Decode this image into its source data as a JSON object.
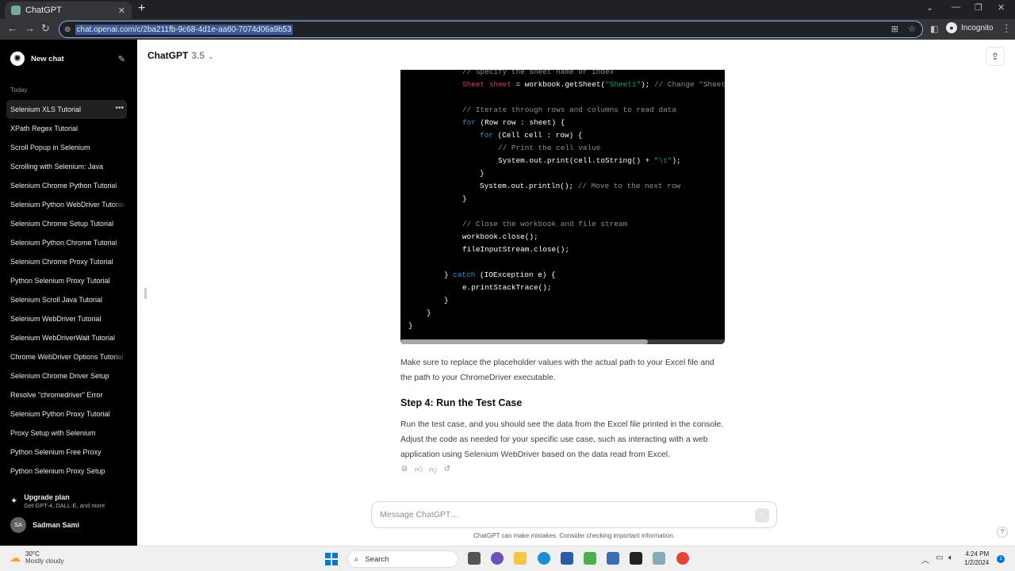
{
  "browser": {
    "tab_title": "ChatGPT",
    "url": "chat.openai.com/c/2ba211fb-9c68-4d1e-aa60-7074d06a9b53",
    "incognito_label": "Incognito"
  },
  "sidebar": {
    "new_chat_label": "New chat",
    "section_label": "Today",
    "history": [
      "Selenium XLS Tutorial",
      "XPath Regex Tutorial",
      "Scroll Popup in Selenium",
      "Scrolling with Selenium: Java",
      "Selenium Chrome Python Tutorial",
      "Selenium Python WebDriver Tutorial",
      "Selenium Chrome Setup Tutorial",
      "Selenium Python Chrome Tutorial",
      "Selenium Chrome Proxy Tutorial",
      "Python Selenium Proxy Tutorial",
      "Selenium Scroll Java Tutorial",
      "Selenium WebDriver Tutorial",
      "Selenium WebDriverWait Tutorial",
      "Chrome WebDriver Options Tutorial",
      "Selenium Chrome Driver Setup",
      "Resolve \"chromedriver\" Error",
      "Selenium Python Proxy Tutorial",
      "Proxy Setup with Selenium",
      "Python Selenium Free Proxy",
      "Python Selenium Proxy Setup"
    ],
    "upgrade_title": "Upgrade plan",
    "upgrade_sub": "Get GPT-4, DALL·E, and more",
    "user_initials": "SA",
    "user_name": "Sadman Sami"
  },
  "main": {
    "model_name": "ChatGPT",
    "model_version": "3.5",
    "code": {
      "l1": "// Specify the sheet name or index",
      "l2_type": "Sheet",
      "l2_var": "sheet",
      "l2_mid": " = workbook.getSheet(",
      "l2_str": "\"Sheet1\"",
      "l2_end": ");",
      "l2_cm": "// Change \"Sheet",
      "l3": "// Iterate through rows and columns to read data",
      "l4_kw": "for",
      "l4_rest": " (Row row : sheet) {",
      "l5_kw": "for",
      "l5_rest": " (Cell cell : row) {",
      "l6": "// Print the cell value",
      "l7_a": "System.out.print(cell.toString() + ",
      "l7_str": "\"\\t\"",
      "l7_b": ");",
      "l8": "}",
      "l9_a": "System.out.println(); ",
      "l9_cm": "// Move to the next row",
      "l10": "}",
      "l11": "// Close the workbook and file stream",
      "l12": "workbook.close();",
      "l13": "fileInputStream.close();",
      "l14_a": "} ",
      "l14_kw": "catch",
      "l14_b": " (IOException e) {",
      "l15": "e.printStackTrace();",
      "l16": "}",
      "l17": "}",
      "l18": "}"
    },
    "para1": "Make sure to replace the placeholder values with the actual path to your Excel file and the path to your ChromeDriver executable.",
    "step_heading": "Step 4: Run the Test Case",
    "para2": "Run the test case, and you should see the data from the Excel file printed in the console. Adjust the code as needed for your specific use case, such as interacting with a web application using Selenium WebDriver based on the data read from Excel.",
    "composer_placeholder": "Message ChatGPT…",
    "disclaimer": "ChatGPT can make mistakes. Consider checking important information."
  },
  "taskbar": {
    "temperature": "30°C",
    "weather": "Mostly cloudy",
    "search_label": "Search",
    "time": "4:24 PM",
    "date": "1/2/2024",
    "notification_count": "1"
  }
}
